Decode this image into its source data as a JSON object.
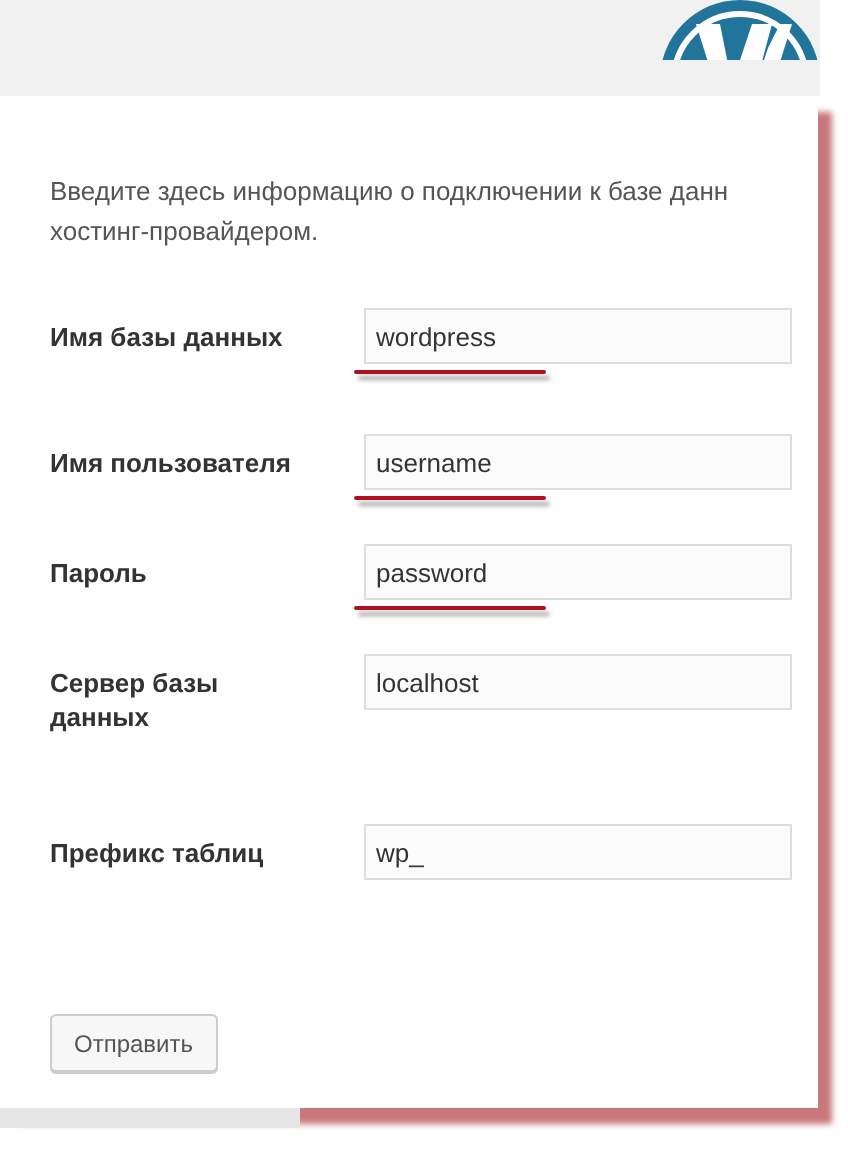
{
  "intro_lines": [
    "Введите здесь информацию о подключении к базе данн",
    "хостинг-провайдером."
  ],
  "fields": [
    {
      "label": "Имя базы данных",
      "value": "wordpress",
      "underlined": true
    },
    {
      "label": "Имя пользователя",
      "value": "username",
      "underlined": true
    },
    {
      "label": "Пароль",
      "value": "password",
      "underlined": true
    },
    {
      "label": "Сервер базы данных",
      "value": "localhost",
      "underlined": false
    },
    {
      "label": "Префикс таблиц",
      "value": "wp_",
      "underlined": false
    }
  ],
  "submit_button": "Отправить"
}
